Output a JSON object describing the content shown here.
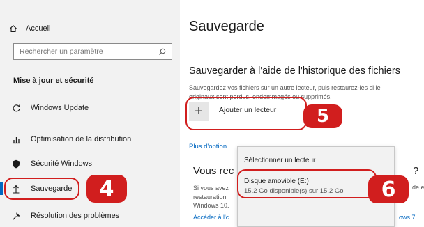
{
  "sidebar": {
    "home_label": "Accueil",
    "search_placeholder": "Rechercher un paramètre",
    "section_title": "Mise à jour et sécurité",
    "items": [
      {
        "label": "Windows Update",
        "icon": "sync-icon"
      },
      {
        "label": "Optimisation de la distribution",
        "icon": "delivery-optimization-icon"
      },
      {
        "label": "Sécurité Windows",
        "icon": "shield-icon"
      },
      {
        "label": "Sauvegarde",
        "icon": "backup-arrow-icon",
        "selected": true
      },
      {
        "label": "Résolution des problèmes",
        "icon": "wrench-icon"
      }
    ]
  },
  "main": {
    "title": "Sauvegarde",
    "subtitle": "Sauvegarder à l'aide de l'historique des fichiers",
    "description_line1": "Sauvegardez vos fichiers sur un autre lecteur, puis restaurez-les si le",
    "description_line2": "originaux sont perdus, endommagés ou supprimés.",
    "add_drive_label": "Ajouter un lecteur",
    "more_options_label": "Plus d'option",
    "section2_title": "Vous rec",
    "section2_title_end": "?",
    "section2_desc_line1": "Si vous avez",
    "section2_desc_line2": "restauration",
    "section2_desc_line3": "Windows 10.",
    "section2_desc_right": "de e",
    "section2_link": "Accéder à l'c",
    "section2_link_right": "ows 7"
  },
  "dropdown": {
    "title": "Sélectionner un lecteur",
    "item_name": "Disque amovible (E:)",
    "item_info": "15.2 Go disponible(s) sur 15.2 Go"
  },
  "callouts": {
    "step4": "4",
    "step5": "5",
    "step6": "6",
    "color": "#d11e1e"
  }
}
